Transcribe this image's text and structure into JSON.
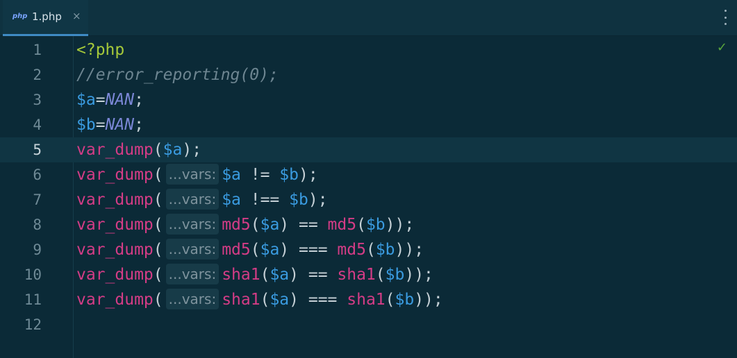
{
  "tab": {
    "file_icon_text": "php",
    "label": "1.php",
    "close_symbol": "×"
  },
  "status": {
    "check_symbol": "✓"
  },
  "gutter": {
    "numbers": [
      "1",
      "2",
      "3",
      "4",
      "5",
      "6",
      "7",
      "8",
      "9",
      "10",
      "11",
      "12"
    ]
  },
  "code": {
    "l1": {
      "tag": "<?php"
    },
    "l2": {
      "comment": "//error_reporting(0);"
    },
    "l3": {
      "var": "$a",
      "eq": "=",
      "const": "NAN",
      "semi": ";"
    },
    "l4": {
      "var": "$b",
      "eq": "=",
      "const": "NAN",
      "semi": ";"
    },
    "l5": {
      "fn": "var_dump",
      "open": "(",
      "var": "$a",
      "close": ");"
    },
    "hint_label": "...vars:",
    "l6": {
      "fn": "var_dump",
      "open": "(",
      "a": "$a",
      "op": " != ",
      "b": "$b",
      "close": ");"
    },
    "l7": {
      "fn": "var_dump",
      "open": "(",
      "a": "$a",
      "op": " !== ",
      "b": "$b",
      "close": ");"
    },
    "l8": {
      "fn": "var_dump",
      "open": "(",
      "fn2": "md5",
      "p1": "(",
      "a": "$a",
      "p2": ")",
      "op": " == ",
      "fn3": "md5",
      "p3": "(",
      "b": "$b",
      "close": "));"
    },
    "l9": {
      "fn": "var_dump",
      "open": "(",
      "fn2": "md5",
      "p1": "(",
      "a": "$a",
      "p2": ")",
      "op": " === ",
      "fn3": "md5",
      "p3": "(",
      "b": "$b",
      "close": "));"
    },
    "l10": {
      "fn": "var_dump",
      "open": "(",
      "fn2": "sha1",
      "p1": "(",
      "a": "$a",
      "p2": ")",
      "op": " == ",
      "fn3": "sha1",
      "p3": "(",
      "b": "$b",
      "close": "));"
    },
    "l11": {
      "fn": "var_dump",
      "open": "(",
      "fn2": "sha1",
      "p1": "(",
      "a": "$a",
      "p2": ")",
      "op": " === ",
      "fn3": "sha1",
      "p3": "(",
      "b": "$b",
      "close": "));"
    }
  },
  "colors": {
    "background": "#0b2a37",
    "php_tag": "#a6c93a",
    "variable": "#3a9be0",
    "function": "#d43c86",
    "constant": "#7b87d6",
    "comment": "#6d8591",
    "tab_accent": "#3f8bc4",
    "check": "#5aa63c"
  }
}
